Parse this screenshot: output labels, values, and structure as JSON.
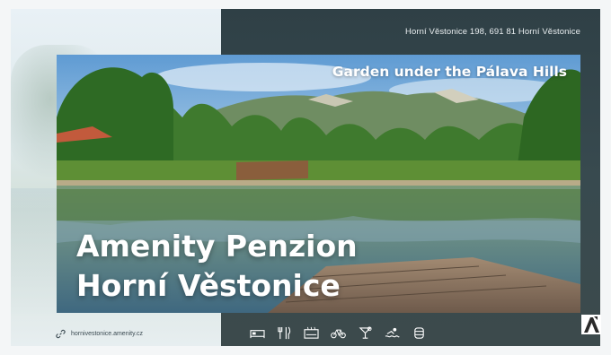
{
  "address": "Horní Věstonice 198, 691 81 Horní Věstonice",
  "tagline": "Garden under the Pálava Hills",
  "title": {
    "line1": "Amenity Penzion",
    "line2": "Horní Věstonice"
  },
  "website": "hornivestonice.amenity.cz",
  "amenities": [
    {
      "name": "bed-icon"
    },
    {
      "name": "restaurant-icon"
    },
    {
      "name": "sauna-icon"
    },
    {
      "name": "bicycle-icon"
    },
    {
      "name": "cocktail-icon"
    },
    {
      "name": "swimming-icon"
    },
    {
      "name": "wine-barrel-icon"
    }
  ],
  "colors": {
    "dark_panel": "#34454b",
    "text_light": "#ffffff",
    "text_dark": "#3b4a52"
  }
}
